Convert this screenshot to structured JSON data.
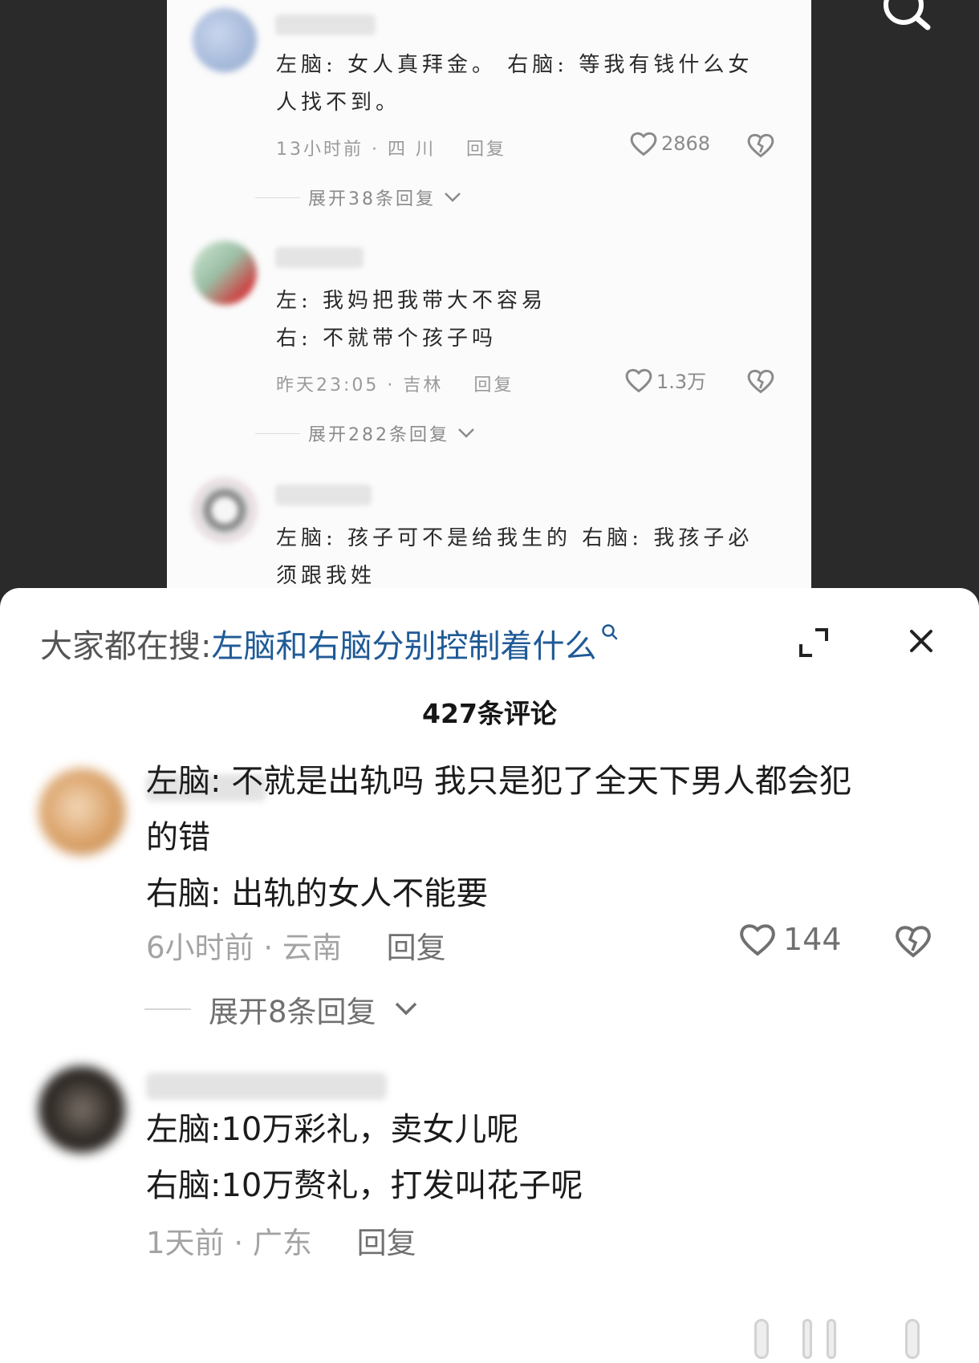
{
  "upper": {
    "comments": [
      {
        "name": "·····iriang",
        "lines": [
          "左脑: 女人真拜金。 右脑: 等我有钱什么女",
          "人找不到。"
        ],
        "time_loc": "13小时前 · 四 川",
        "reply": "回复",
        "likes": "2868",
        "expand": "展开38条回复"
      },
      {
        "name": "",
        "lines": [
          "左: 我妈把我带大不容易",
          "右: 不就带个孩子吗"
        ],
        "time_loc": "昨天23:05 · 吉林",
        "reply": "回复",
        "likes": "1.3万",
        "expand": "展开282条回复"
      },
      {
        "name": "·····小狗",
        "lines": [
          "左脑: 孩子可不是给我生的 右脑: 我孩子必",
          "须跟我姓"
        ]
      }
    ]
  },
  "sheet": {
    "hot_search_prefix": "大家都在搜:",
    "hot_search_query": "左脑和右脑分别控制着什么",
    "comment_count": "427条评论",
    "comments": [
      {
        "name": "",
        "lines": [
          "左脑: 不就是出轨吗 我只是犯了全天下男人都会犯",
          "的错",
          "右脑: 出轨的女人不能要"
        ],
        "time": "6小时前",
        "location": "云南",
        "reply": "回复",
        "likes": "144",
        "expand": "展开8条回复"
      },
      {
        "name": "",
        "lines": [
          "左脑:10万彩礼，卖女儿呢",
          "右脑:10万赘礼，打发叫花子呢"
        ],
        "time": "1天前",
        "location": "广东",
        "reply": "回复"
      }
    ]
  },
  "colors": {
    "link_blue": "#1f5a96",
    "backdrop": "#2a2a2a",
    "meta_gray": "#a3a3a3"
  },
  "icons": [
    "search-icon",
    "heart-icon",
    "broken-heart-icon",
    "chevron-down-icon",
    "expand-icon",
    "close-icon",
    "magnifier-icon"
  ]
}
